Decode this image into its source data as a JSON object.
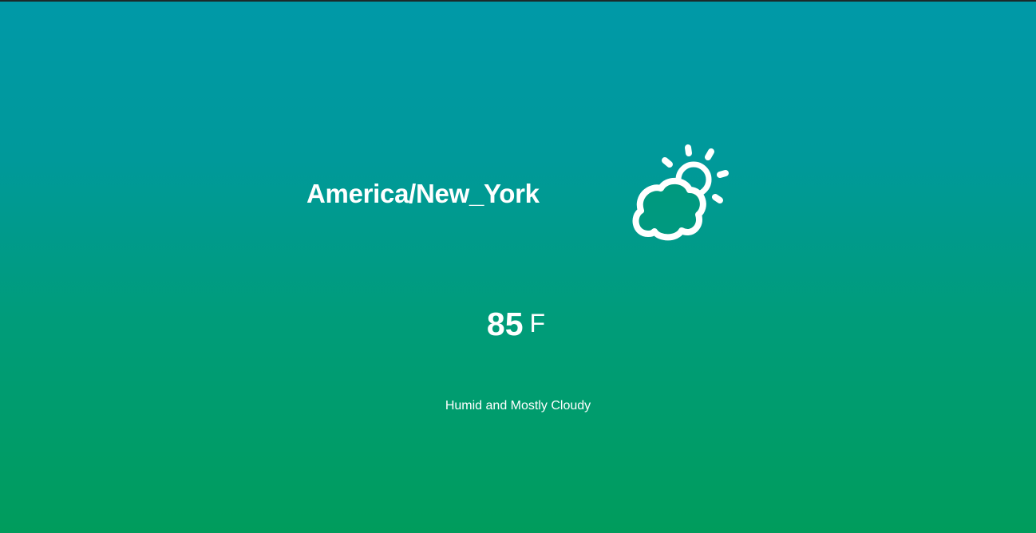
{
  "location": {
    "timezone": "America/New_York"
  },
  "current": {
    "icon": "partly-cloudy-day-icon",
    "temperature": "85",
    "unit": "F",
    "summary": "Humid and Mostly Cloudy"
  },
  "theme": {
    "gradient_top": "#0099a8",
    "gradient_bottom": "#009c5c",
    "text_color": "#ffffff"
  }
}
